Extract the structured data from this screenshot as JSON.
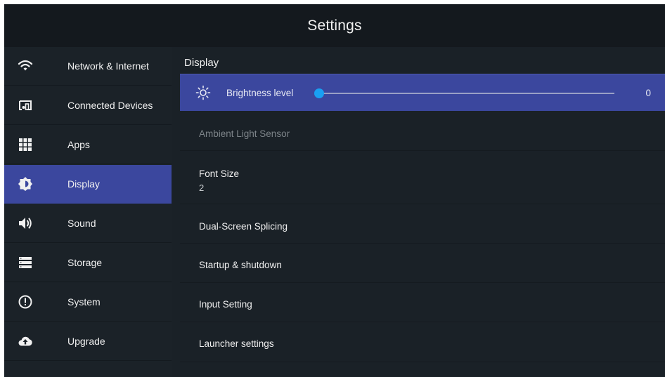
{
  "window": {
    "title": "Settings"
  },
  "sidebar": {
    "items": [
      {
        "label": "Network & Internet",
        "icon": "wifi-icon",
        "active": false
      },
      {
        "label": "Connected Devices",
        "icon": "connected-devices-icon",
        "active": false
      },
      {
        "label": "Apps",
        "icon": "apps-grid-icon",
        "active": false
      },
      {
        "label": "Display",
        "icon": "display-brightness-icon",
        "active": true
      },
      {
        "label": "Sound",
        "icon": "speaker-icon",
        "active": false
      },
      {
        "label": "Storage",
        "icon": "storage-icon",
        "active": false
      },
      {
        "label": "System",
        "icon": "info-icon",
        "active": false
      },
      {
        "label": "Upgrade",
        "icon": "cloud-upload-icon",
        "active": false
      }
    ]
  },
  "main": {
    "section_title": "Display",
    "brightness": {
      "label": "Brightness level",
      "value": "0",
      "level": 0,
      "icon": "sun-icon"
    },
    "items": [
      {
        "label": "Ambient Light Sensor",
        "disabled": true
      },
      {
        "label": "Font Size",
        "value": "2"
      },
      {
        "label": "Dual-Screen Splicing"
      },
      {
        "label": "Startup & shutdown"
      },
      {
        "label": "Input Setting"
      },
      {
        "label": "Launcher settings"
      }
    ]
  },
  "colors": {
    "accent": "#3b479e",
    "slider": "#19a0f2",
    "sidebar_bg": "#1b2228",
    "content_bg": "#1a2127",
    "titlebar_bg": "#14191e"
  }
}
